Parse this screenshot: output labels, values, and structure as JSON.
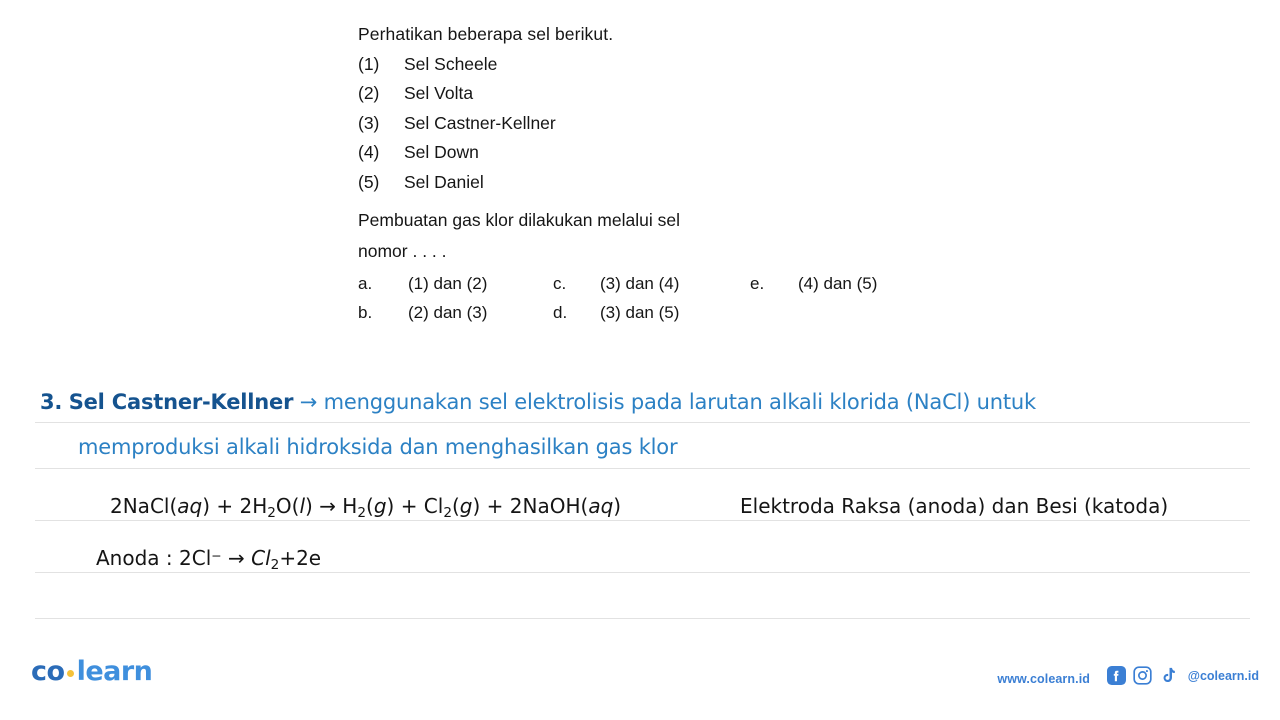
{
  "question": {
    "intro": "Perhatikan beberapa sel berikut.",
    "items": [
      {
        "num": "(1)",
        "label": "Sel Scheele"
      },
      {
        "num": "(2)",
        "label": "Sel Volta"
      },
      {
        "num": "(3)",
        "label": "Sel Castner-Kellner"
      },
      {
        "num": "(4)",
        "label": "Sel Down"
      },
      {
        "num": "(5)",
        "label": "Sel Daniel"
      }
    ],
    "prompt_line1": "Pembuatan gas klor dilakukan melalui sel",
    "prompt_line2": "nomor . . . .",
    "options": [
      {
        "letter": "a.",
        "text": "(1) dan (2)"
      },
      {
        "letter": "c.",
        "text": "(3) dan (4)"
      },
      {
        "letter": "e.",
        "text": "(4) dan (5)"
      },
      {
        "letter": "b.",
        "text": "(2) dan (3)"
      },
      {
        "letter": "d.",
        "text": "(3) dan (5)"
      }
    ]
  },
  "answer": {
    "number": "3.",
    "term": "Sel Castner-Kellner",
    "arrow": "→",
    "body_line1": "menggunakan sel elektrolisis pada larutan alkali klorida (NaCl) untuk",
    "body_line2": "memproduksi alkali hidroksida dan menghasilkan gas klor",
    "accent_dark": "#15538f",
    "accent_light": "#2c81c4"
  },
  "equations": {
    "overall": {
      "parts": "2NaCl(aq) + 2H2O(l) → H2(g) + Cl2(g) + 2NaOH(aq)",
      "coef_nacl": "2NaCl(",
      "state_aq1": "aq",
      "plus1": ") + 2H",
      "sub_2a": "2",
      "o_open": "O(",
      "state_l": "l",
      "arrow": ") → H",
      "sub_2b": "2",
      "g_open1": "(",
      "state_g1": "g",
      "plus2": ") + Cl",
      "sub_2c": "2",
      "g_open2": "(",
      "state_g2": "g",
      "plus3": ") + 2NaOH(",
      "state_aq2": "aq",
      "close": ")"
    },
    "electrode_note": "Elektroda Raksa (anoda) dan Besi (katoda)",
    "anode": {
      "label": "Anoda : 2Cl",
      "charge": "−",
      "arrow": "→",
      "product": "Cl",
      "product_sub": "2",
      "electrons": "+2e"
    }
  },
  "footer": {
    "logo_first": "co",
    "logo_second": "learn",
    "website": "www.colearn.id",
    "handle": "@colearn.id",
    "icons": [
      "facebook-icon",
      "instagram-icon",
      "tiktok-icon"
    ],
    "brand_color": "#3b7fd4"
  }
}
